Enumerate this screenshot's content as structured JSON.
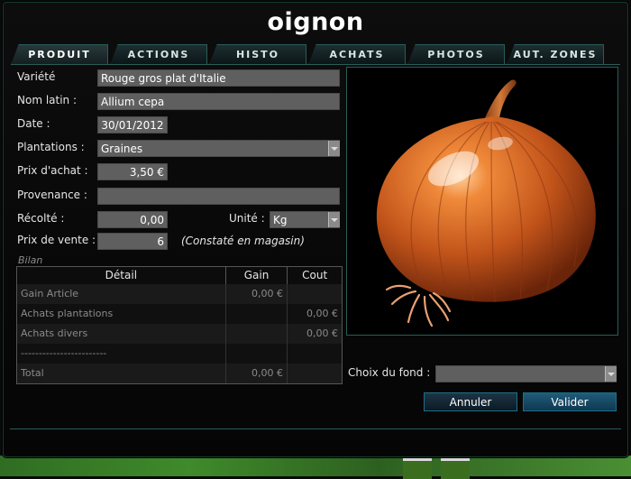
{
  "title": "oignon",
  "tabs": [
    "PRODUIT",
    "ACTIONS",
    "HISTO",
    "ACHATS",
    "PHOTOS",
    "AUT. ZONES"
  ],
  "form": {
    "variete_label": "Variété",
    "variete_value": "Rouge gros plat d'Italie",
    "nom_latin_label": "Nom latin :",
    "nom_latin_value": "Allium cepa",
    "date_label": "Date :",
    "date_value": "30/01/2012",
    "plantations_label": "Plantations :",
    "plantations_value": "Graines",
    "prix_achat_label": "Prix d'achat :",
    "prix_achat_value": "3,50 €",
    "provenance_label": "Provenance :",
    "provenance_value": "",
    "recolte_label": "Récolté :",
    "recolte_value": "0,00",
    "unite_label": "Unité :",
    "unite_value": "Kg",
    "prix_vente_label": "Prix de vente :",
    "prix_vente_value": "6",
    "prix_vente_note": "(Constaté en magasin)"
  },
  "bilan": {
    "label": "Bilan",
    "headers": [
      "Détail",
      "Gain",
      "Cout"
    ],
    "rows": [
      [
        "Gain Article",
        "0,00 €",
        ""
      ],
      [
        "Achats plantations",
        "",
        "0,00 €"
      ],
      [
        "Achats divers",
        "",
        "0,00 €"
      ],
      [
        "------------------------",
        "",
        ""
      ],
      [
        "Total",
        "0,00 €",
        ""
      ]
    ]
  },
  "photo": {
    "icon": "onion-image"
  },
  "choix_fond_label": "Choix du fond :",
  "choix_fond_value": "",
  "buttons": {
    "annuler": "Annuler",
    "valider": "Valider"
  },
  "colors": {
    "accent": "#2a5c57",
    "field": "#5f5f5f",
    "button_border": "#1e6f88"
  }
}
